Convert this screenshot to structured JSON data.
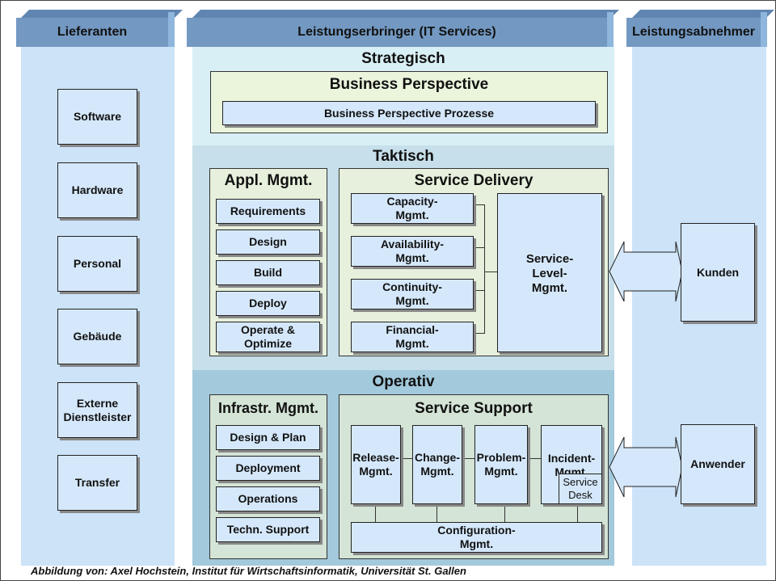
{
  "columns": {
    "suppliers": {
      "header": "Lieferanten",
      "items": [
        "Software",
        "Hardware",
        "Personal",
        "Gebäude",
        "Externe Dienstleister",
        "Transfer"
      ]
    },
    "provider": {
      "header": "Leistungserbringer (IT Services)"
    },
    "consumers": {
      "header": "Leistungsabnehmer",
      "items": [
        "Kunden",
        "Anwender"
      ]
    }
  },
  "strategic": {
    "title": "Strategisch",
    "group_title": "Business Perspective",
    "processes_label": "Business Perspective Prozesse"
  },
  "tactical": {
    "title": "Taktisch",
    "appl_mgmt": {
      "title": "Appl. Mgmt.",
      "items": [
        "Requirements",
        "Design",
        "Build",
        "Deploy",
        "Operate & Optimize"
      ]
    },
    "service_delivery": {
      "title": "Service Delivery",
      "items": [
        "Capacity-\nMgmt.",
        "Availability-\nMgmt.",
        "Continuity-\nMgmt.",
        "Financial-\nMgmt."
      ],
      "slm": "Service-\nLevel-\nMgmt."
    }
  },
  "operational": {
    "title": "Operativ",
    "infra_mgmt": {
      "title": "Infrastr. Mgmt.",
      "items": [
        "Design & Plan",
        "Deployment",
        "Operations",
        "Techn. Support"
      ]
    },
    "service_support": {
      "title": "Service Support",
      "items": [
        "Release-\nMgmt.",
        "Change-\nMgmt.",
        "Problem-\nMgmt.",
        "Incident-\nMgmt."
      ],
      "service_desk": "Service\nDesk",
      "config": "Configuration-\nMgmt."
    }
  },
  "caption": "Abbildung von: Axel Hochstein, Institut für Wirtschaftsinformatik, Universität St. Gallen",
  "colors": {
    "column_bg": "#cce3f8",
    "header": "#7399c2",
    "box": "#d5e8fb",
    "group": "#e6f0dc",
    "strategic_bg": "#d8eff5",
    "tactical_bg": "#c6dfea",
    "operational_bg": "#a2c9dc"
  }
}
